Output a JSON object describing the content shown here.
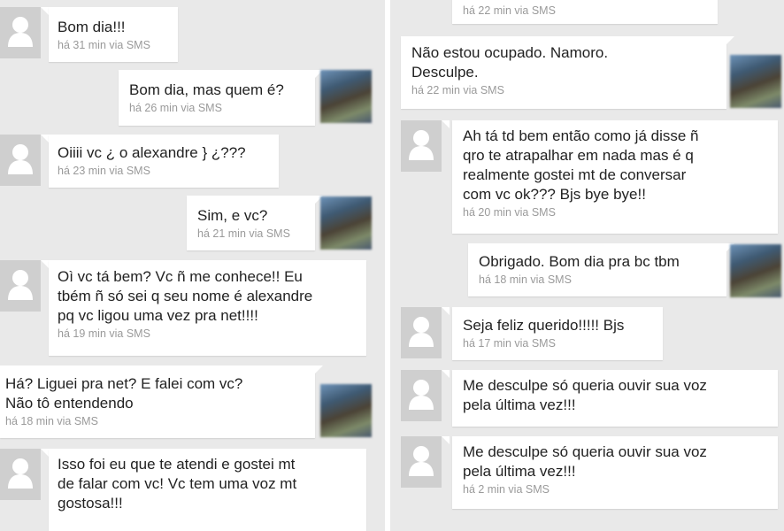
{
  "left_messages": [
    {
      "text": "Bom dia!!!",
      "meta": "há 31 min via SMS"
    },
    {
      "text": "Bom dia, mas quem é?",
      "meta": "há 26 min via SMS"
    },
    {
      "text": "Oiiii vc ¿ o alexandre } ¿???",
      "meta": "há 23 min via SMS"
    },
    {
      "text": "Sim, e vc?",
      "meta": "há 21 min via SMS"
    },
    {
      "text": "Oì vc tá bem? Vc ñ me conhece!! Eu\ntbém ñ só sei q seu nome é alexandre\npq vc ligou uma vez pra net!!!!",
      "meta": "há 19 min via SMS"
    },
    {
      "text": "Há? Liguei pra net? E falei com vc?\nNão tô entendendo",
      "meta": "há 18 min via SMS"
    },
    {
      "text": "Isso foi eu que te atendi e gostei mt\nde falar com vc! Vc tem uma voz mt\ngostosa!!!"
    }
  ],
  "right_messages": [
    {
      "meta": "há 22 min via SMS"
    },
    {
      "text": "Não estou ocupado. Namoro.\nDesculpe.",
      "meta": "há 22 min via SMS"
    },
    {
      "text": "Ah tá td bem então como já disse ñ\nqro te atrapalhar em nada mas é q\nrealmente gostei mt de conversar\ncom vc ok??? Bjs bye bye!!",
      "meta": "há 20 min via SMS"
    },
    {
      "text": "Obrigado. Bom dia pra bc tbm",
      "meta": "há 18 min via SMS"
    },
    {
      "text": "Seja feliz querido!!!!! Bjs",
      "meta": "há 17 min via SMS"
    },
    {
      "text": "Me desculpe só queria ouvir sua voz\npela última vez!!!"
    },
    {
      "text": "Me desculpe só queria ouvir sua voz\npela última vez!!!",
      "meta": "há 2 min via SMS"
    }
  ]
}
